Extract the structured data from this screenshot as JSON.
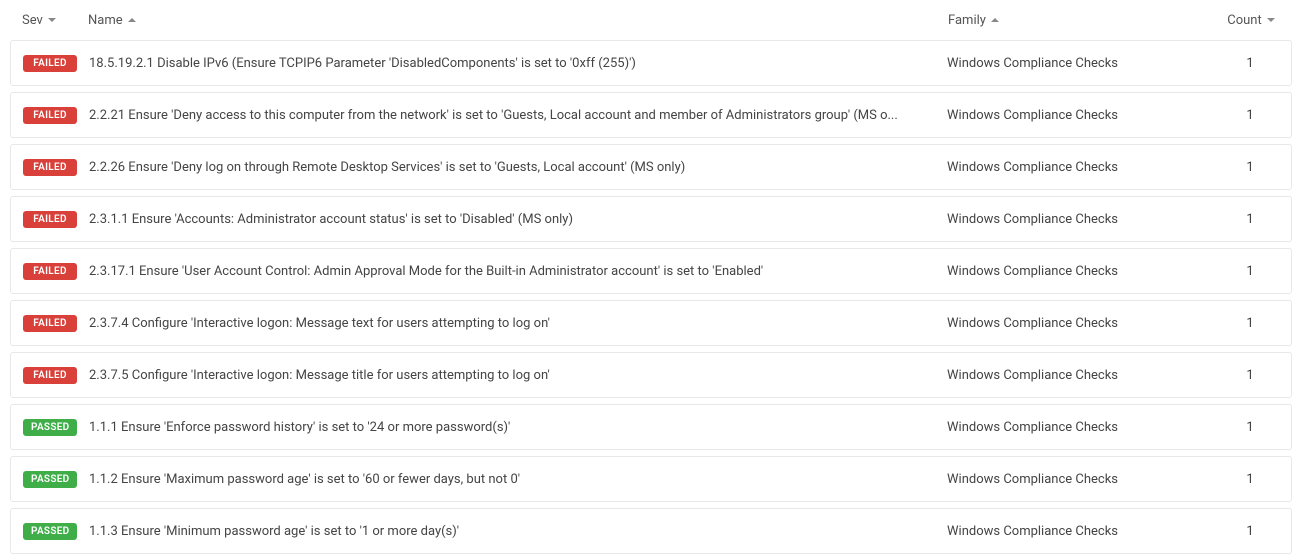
{
  "colors": {
    "failed": "#d9403a",
    "passed": "#3fae49"
  },
  "columns": {
    "sev": {
      "label": "Sev",
      "sort": "down"
    },
    "name": {
      "label": "Name",
      "sort": "up"
    },
    "family": {
      "label": "Family",
      "sort": "up"
    },
    "count": {
      "label": "Count",
      "sort": "down"
    }
  },
  "status_labels": {
    "failed": "FAILED",
    "passed": "PASSED"
  },
  "rows": [
    {
      "status": "failed",
      "name": "18.5.19.2.1 Disable IPv6 (Ensure TCPIP6 Parameter 'DisabledComponents' is set to '0xff (255)')",
      "family": "Windows Compliance Checks",
      "count": 1
    },
    {
      "status": "failed",
      "name": "2.2.21 Ensure 'Deny access to this computer from the network' is set to 'Guests, Local account and member of Administrators group' (MS o...",
      "family": "Windows Compliance Checks",
      "count": 1
    },
    {
      "status": "failed",
      "name": "2.2.26 Ensure 'Deny log on through Remote Desktop Services' is set to 'Guests, Local account' (MS only)",
      "family": "Windows Compliance Checks",
      "count": 1
    },
    {
      "status": "failed",
      "name": "2.3.1.1 Ensure 'Accounts: Administrator account status' is set to 'Disabled' (MS only)",
      "family": "Windows Compliance Checks",
      "count": 1
    },
    {
      "status": "failed",
      "name": "2.3.17.1 Ensure 'User Account Control: Admin Approval Mode for the Built-in Administrator account' is set to 'Enabled'",
      "family": "Windows Compliance Checks",
      "count": 1
    },
    {
      "status": "failed",
      "name": "2.3.7.4 Configure 'Interactive logon: Message text for users attempting to log on'",
      "family": "Windows Compliance Checks",
      "count": 1
    },
    {
      "status": "failed",
      "name": "2.3.7.5 Configure 'Interactive logon: Message title for users attempting to log on'",
      "family": "Windows Compliance Checks",
      "count": 1
    },
    {
      "status": "passed",
      "name": "1.1.1 Ensure 'Enforce password history' is set to '24 or more password(s)'",
      "family": "Windows Compliance Checks",
      "count": 1
    },
    {
      "status": "passed",
      "name": "1.1.2 Ensure 'Maximum password age' is set to '60 or fewer days, but not 0'",
      "family": "Windows Compliance Checks",
      "count": 1
    },
    {
      "status": "passed",
      "name": "1.1.3 Ensure 'Minimum password age' is set to '1 or more day(s)'",
      "family": "Windows Compliance Checks",
      "count": 1
    }
  ]
}
